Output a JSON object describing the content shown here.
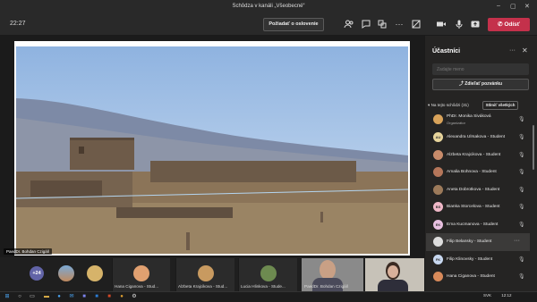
{
  "window": {
    "title": "Schôdza v kanáli „Všeobecné“",
    "min": "–",
    "max": "▢",
    "close": "✕"
  },
  "toolbar": {
    "timer": "22:27",
    "raise_hand": "Požiadať o oslovenie",
    "leave": "Odísť",
    "leave_icon": "phone-icon"
  },
  "stage": {
    "presenter": "PaedDr. Bohdan Czigáň"
  },
  "gallery": {
    "more_count": "+24",
    "tiles": [
      "Hana Ciganova - Stud...",
      "Alzbeta Krajcikova - Stud...",
      "Lucia Hlinkova - Stude...",
      "PaedDr. Bohdan Czigáň"
    ]
  },
  "panel": {
    "title": "Účastníci",
    "more": "···",
    "close": "✕",
    "input_placeholder": "Zadajte meno",
    "share_label": "Zdieľať pozvánku",
    "section": "Na tejto schôdzi (31)",
    "mute_all": "Stlmiť všetkých",
    "participants": [
      {
        "initials": "",
        "name": "PhDr. Monika Siváková",
        "role": "Organizátor",
        "color": "#d9a35a"
      },
      {
        "initials": "AU",
        "name": "Alexandra Ulrsakova - Student",
        "role": "",
        "color": "#e8d59c"
      },
      {
        "initials": "",
        "name": "Alzbeta Krajcikova - Student",
        "role": "",
        "color": "#c88b6a"
      },
      {
        "initials": "",
        "name": "Amalia Bohnova - Student",
        "role": "",
        "color": "#b5765a"
      },
      {
        "initials": "",
        "name": "Aneta Dobrotkova - Student",
        "role": "",
        "color": "#9c7a5a"
      },
      {
        "initials": "BS",
        "name": "Bianka Storcelova - Student",
        "role": "",
        "color": "#f0b8c8"
      },
      {
        "initials": "EK",
        "name": "Ema Kucmanova - Student",
        "role": "",
        "color": "#e8c0e0"
      },
      {
        "initials": "",
        "name": "Filip Belansky - Student",
        "role": "",
        "color": "#dddddd"
      },
      {
        "initials": "FK",
        "name": "Filip Klinovsky - Student",
        "role": "",
        "color": "#c8d8f0"
      },
      {
        "initials": "",
        "name": "Hana Ciganova - Student",
        "role": "",
        "color": "#d88a5a"
      }
    ]
  },
  "taskbar": {
    "lang": "SVK",
    "time": "12:12"
  },
  "colors": {
    "accent": "#6264a7",
    "leave": "#c4314b",
    "bg": "#1f1f1f"
  }
}
